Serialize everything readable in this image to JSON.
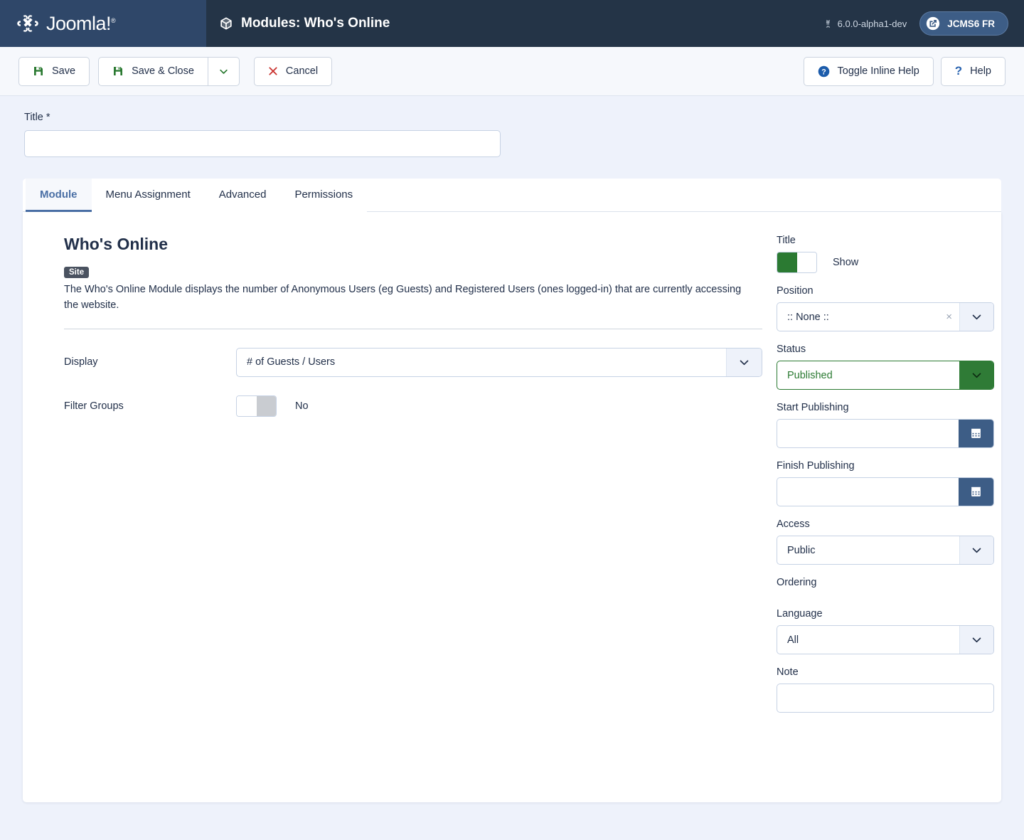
{
  "header": {
    "brand": "Joomla!",
    "brand_trademark": "®",
    "page_title": "Modules: Who's Online",
    "version": "6.0.0-alpha1-dev",
    "site_link_label": "JCMS6 FR"
  },
  "toolbar": {
    "save_label": "Save",
    "save_close_label": "Save & Close",
    "cancel_label": "Cancel",
    "toggle_inline_help_label": "Toggle Inline Help",
    "help_label": "Help"
  },
  "title_field": {
    "label": "Title *",
    "value": "",
    "placeholder": ""
  },
  "tabs": [
    {
      "label": "Module",
      "active": true
    },
    {
      "label": "Menu Assignment",
      "active": false
    },
    {
      "label": "Advanced",
      "active": false
    },
    {
      "label": "Permissions",
      "active": false
    }
  ],
  "module": {
    "heading": "Who's Online",
    "badge": "Site",
    "description": "The Who's Online Module displays the number of Anonymous Users (eg Guests) and Registered Users (ones logged-in) that are currently accessing the website.",
    "display": {
      "label": "Display",
      "value": "# of Guests / Users"
    },
    "filter_groups": {
      "label": "Filter Groups",
      "value": "No",
      "state": "off"
    }
  },
  "sidebar": {
    "title": {
      "label": "Title",
      "value": "Show",
      "state": "on"
    },
    "position": {
      "label": "Position",
      "value": ":: None ::",
      "clear": "×"
    },
    "status": {
      "label": "Status",
      "value": "Published"
    },
    "start_publishing": {
      "label": "Start Publishing",
      "value": ""
    },
    "finish_publishing": {
      "label": "Finish Publishing",
      "value": ""
    },
    "access": {
      "label": "Access",
      "value": "Public"
    },
    "ordering": {
      "label": "Ordering"
    },
    "language": {
      "label": "Language",
      "value": "All"
    },
    "note": {
      "label": "Note",
      "value": ""
    }
  },
  "colors": {
    "header_dark": "#243447",
    "header_logo": "#2f4769",
    "page_bg": "#eef2fb",
    "accent_blue": "#4a6fa5",
    "green": "#2b7a32",
    "red": "#c9302c",
    "badge_gray": "#4a5260"
  }
}
